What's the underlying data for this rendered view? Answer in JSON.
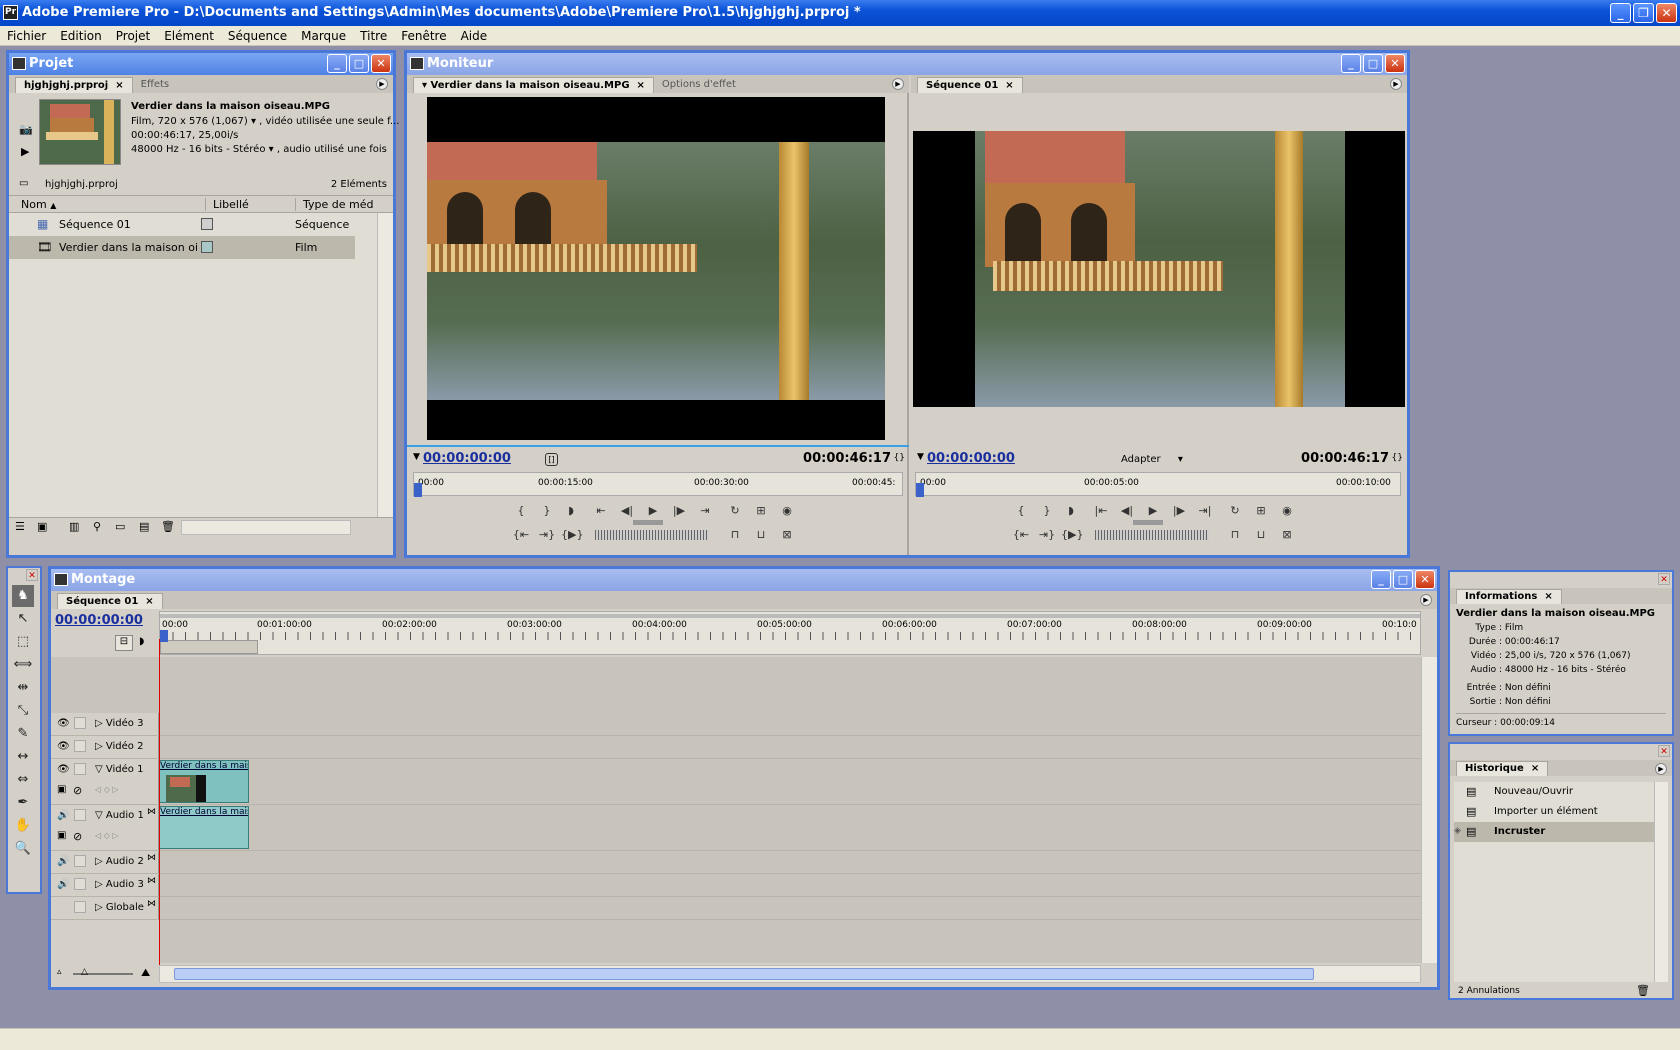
{
  "app": {
    "title": "Adobe Premiere Pro - D:\\Documents and Settings\\Admin\\Mes documents\\Adobe\\Premiere Pro\\1.5\\hjghjghj.prproj *"
  },
  "menu": [
    "Fichier",
    "Edition",
    "Projet",
    "Elément",
    "Séquence",
    "Marque",
    "Titre",
    "Fenêtre",
    "Aide"
  ],
  "project": {
    "title": "Projet",
    "tabs": [
      "hjghjghj.prproj",
      "Effets"
    ],
    "clip_name": "Verdier dans la maison oiseau.MPG",
    "clip_line1": "Film, 720 x 576 (1,067)",
    "clip_line1b": ", vidéo utilisée une seule f...",
    "clip_line2": "00:00:46:17, 25,00i/s",
    "clip_line3": "48000 Hz - 16 bits - Stéréo",
    "clip_line3b": ", audio utilisé une fois",
    "bin": "hjghjghj.prproj",
    "count": "2 Eléments",
    "columns": [
      "Nom",
      "Libellé",
      "Type de méd"
    ],
    "rows": [
      {
        "name": "Séquence 01",
        "type": "Séquence"
      },
      {
        "name": "Verdier dans la maison oiseau.M",
        "type": "Film"
      }
    ]
  },
  "monitor": {
    "title": "Moniteur",
    "source_tabs": [
      "Verdier dans la maison oiseau.MPG",
      "Options d'effet"
    ],
    "source_tc": "00:00:00:00",
    "source_dur": "00:00:46:17",
    "source_ruler": [
      "00:00",
      "00:00:15:00",
      "00:00:30:00",
      "00:00:45:"
    ],
    "prog_tab": "Séquence 01",
    "prog_tc": "00:00:00:00",
    "prog_fit": "Adapter",
    "prog_dur": "00:00:46:17",
    "prog_ruler": [
      "00:00",
      "00:00:05:00",
      "00:00:10:00"
    ]
  },
  "timeline": {
    "title": "Montage",
    "tab": "Séquence 01",
    "tc": "00:00:00:00",
    "ruler": [
      "00:00",
      "00:01:00:00",
      "00:02:00:00",
      "00:03:00:00",
      "00:04:00:00",
      "00:05:00:00",
      "00:06:00:00",
      "00:07:00:00",
      "00:08:00:00",
      "00:09:00:00",
      "00:10:0"
    ],
    "tracks": [
      "Vidéo 3",
      "Vidéo 2",
      "Vidéo 1",
      "Audio 1",
      "Audio 2",
      "Audio 3",
      "Globale"
    ],
    "clip_label": "Verdier dans la maiso"
  },
  "info": {
    "tab": "Informations",
    "name": "Verdier dans la maison oiseau.MPG",
    "lines": [
      {
        "k": "Type :",
        "v": "Film"
      },
      {
        "k": "Durée :",
        "v": "00:00:46:17"
      },
      {
        "k": "Vidéo :",
        "v": "25,00 i/s, 720 x 576 (1,067)"
      },
      {
        "k": "Audio :",
        "v": "48000 Hz - 16 bits - Stéréo"
      }
    ],
    "lines2": [
      {
        "k": "Entrée :",
        "v": "Non défini"
      },
      {
        "k": "Sortie :",
        "v": "Non défini"
      }
    ],
    "cursor_k": "Curseur :",
    "cursor_v": "00:00:09:14"
  },
  "history": {
    "tab": "Historique",
    "items": [
      "Nouveau/Ouvrir",
      "Importer un élément",
      "Incruster"
    ],
    "footer": "2 Annulations"
  }
}
